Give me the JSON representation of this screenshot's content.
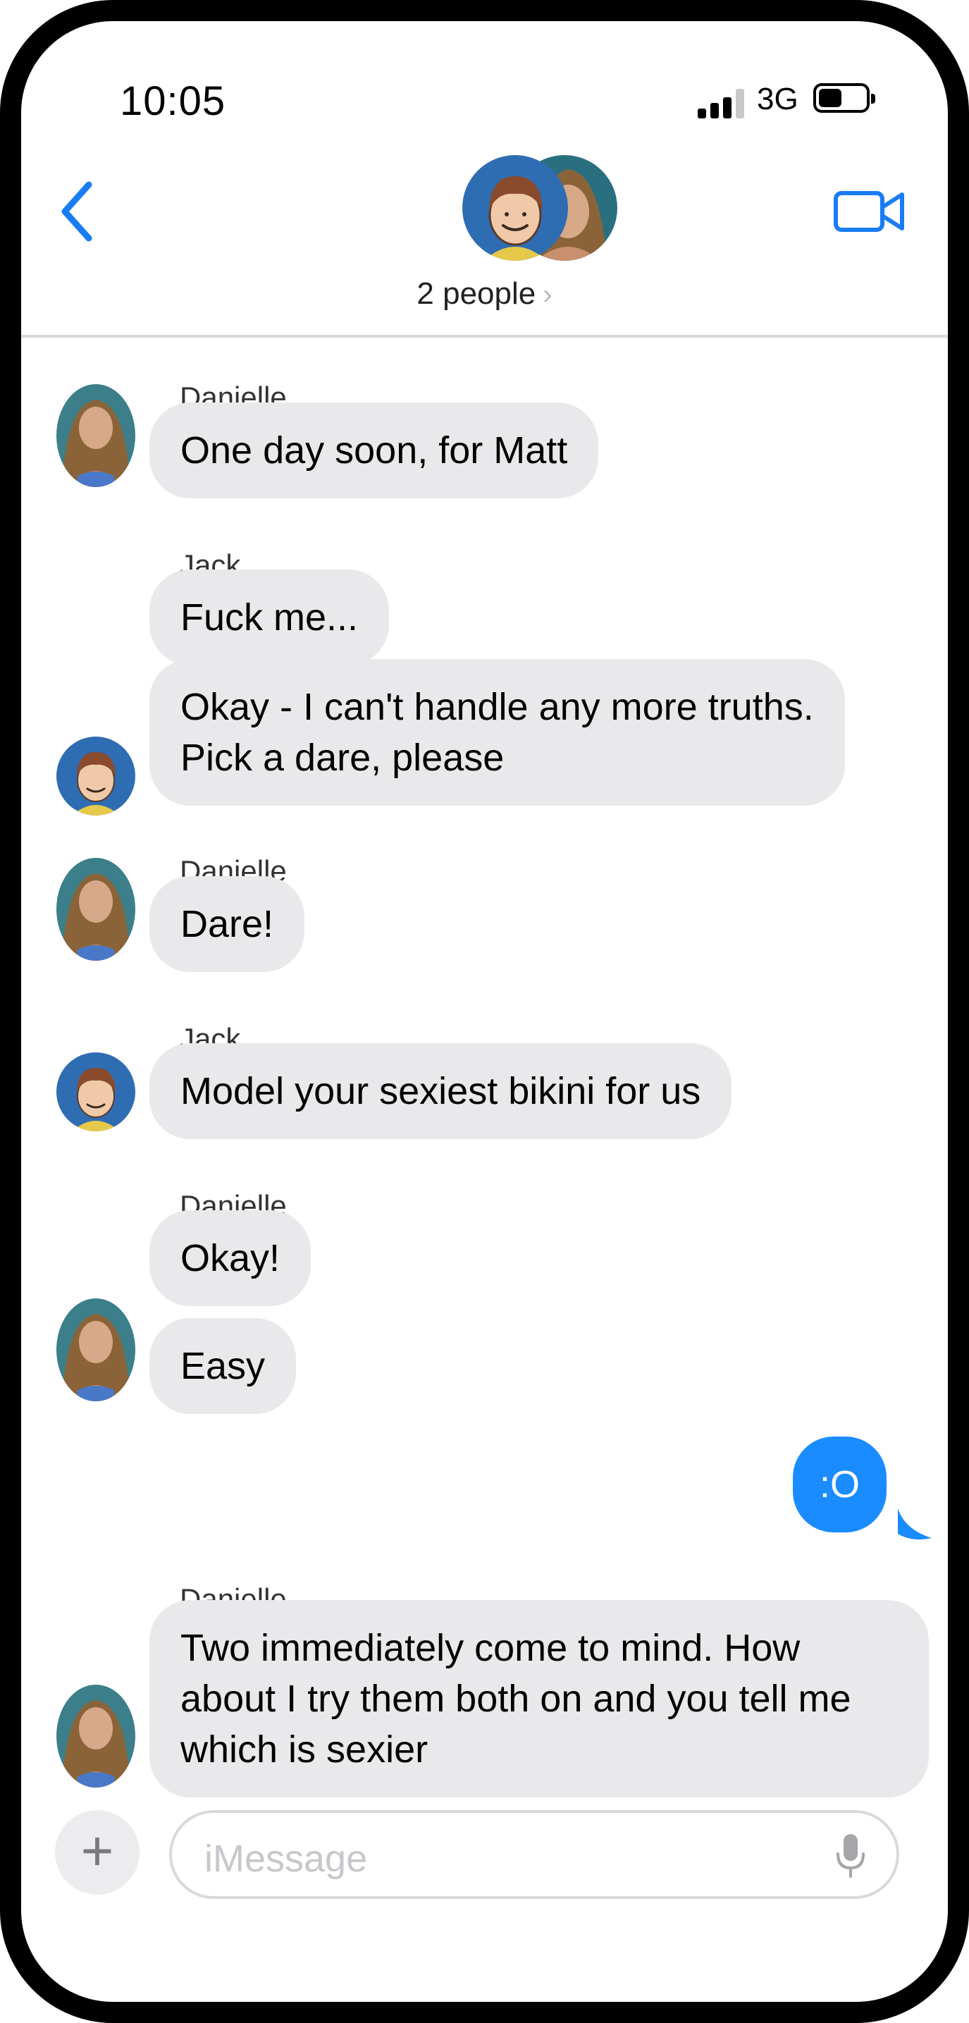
{
  "status_bar": {
    "time": "10:05",
    "network": "3G",
    "battery_level": 0.5
  },
  "header": {
    "participants_label": "2 people",
    "chevron": "›"
  },
  "messages": [
    {
      "sender": "Danielle",
      "text": "One day soon, for Matt"
    },
    {
      "sender": "Jack",
      "text": "Fuck me..."
    },
    {
      "text_line1": "Okay - I can't handle any more truths.",
      "text_line2": "Pick a dare, please"
    },
    {
      "sender": "Danielle",
      "text": "Dare!"
    },
    {
      "sender": "Jack",
      "text": "Model your sexiest bikini for us"
    },
    {
      "sender": "Danielle",
      "text": "Okay!"
    },
    {
      "text": "Easy"
    },
    {
      "sender": "me",
      "text": ":O"
    },
    {
      "sender": "Danielle",
      "text_line1": "Two immediately come to mind.  How",
      "text_line2": "about I try them both on and you tell me",
      "text_line3": "which is sexier"
    }
  ],
  "composer": {
    "placeholder": "iMessage",
    "plus": "+"
  },
  "colors": {
    "accent": "#1a7cf5",
    "bubble_gray": "#e9e9eb",
    "bubble_blue": "#1a8cff"
  },
  "icons": [
    "back-chevron-icon",
    "video-camera-icon",
    "microphone-icon",
    "plus-icon",
    "cellular-signal-icon",
    "battery-icon"
  ]
}
